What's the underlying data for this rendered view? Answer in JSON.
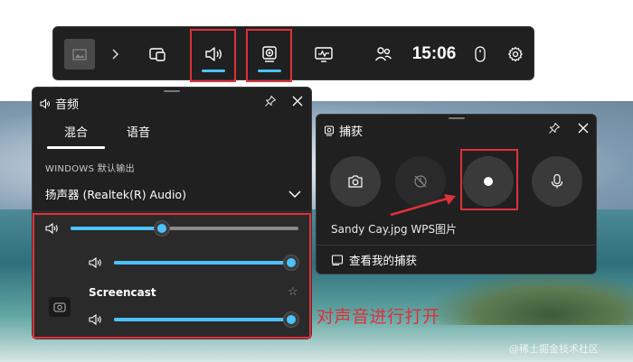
{
  "topbar": {
    "time": "15:06",
    "items": [
      "gallery-thumbnail",
      "expand-chevron",
      "widget-menu",
      "audio",
      "capture",
      "performance",
      "social",
      "mouse",
      "settings"
    ]
  },
  "audio_panel": {
    "title": "音频",
    "tabs": [
      {
        "label": "混合",
        "active": true
      },
      {
        "label": "语音",
        "active": false
      }
    ],
    "section_label": "WINDOWS 默认输出",
    "device": "扬声器 (Realtek(R) Audio)",
    "master_volume": 0.4,
    "apps": [
      {
        "name": "",
        "volume": 1.0
      },
      {
        "name": "Screencast",
        "volume": 1.0
      }
    ]
  },
  "capture_panel": {
    "title": "捕获",
    "buttons": [
      "screenshot",
      "record-last",
      "record",
      "microphone"
    ],
    "last_capture": "Sandy Cay.jpg  WPS图片",
    "view_link": "查看我的捕获"
  },
  "annotation": {
    "text": "对声音进行打开",
    "color": "#e0303a"
  },
  "watermark": "@稀土掘金技术社区",
  "colors": {
    "accent": "#4cc2ff",
    "panel_bg": "#202020",
    "highlight": "#e0303a"
  }
}
